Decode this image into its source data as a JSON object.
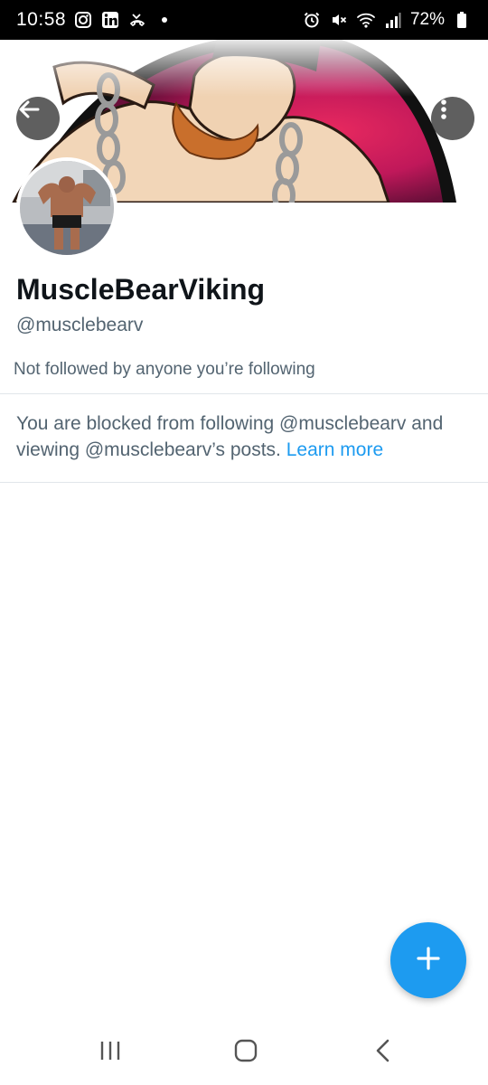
{
  "status_bar": {
    "time": "10:58",
    "battery": "72%",
    "left_icons": [
      "instagram-icon",
      "linkedin-icon",
      "missed-call-icon",
      "dot-icon"
    ],
    "right_icons": [
      "alarm-icon",
      "mute-icon",
      "wifi-icon",
      "signal-icon",
      "battery-icon"
    ]
  },
  "header": {
    "back_icon": "arrow-left-icon",
    "more_icon": "more-vertical-icon"
  },
  "profile": {
    "display_name": "MuscleBearViking",
    "handle": "@musclebearv",
    "followers_note": "Not followed by anyone you’re following"
  },
  "blocked": {
    "message": "You are blocked from following @musclebearv and viewing @musclebearv’s posts.",
    "link": "Learn more"
  },
  "fab": {
    "icon": "plus-icon"
  },
  "nav": {
    "icons": [
      "recent-apps-icon",
      "home-icon",
      "back-icon"
    ]
  },
  "colors": {
    "accent": "#1d9bf0",
    "text_primary": "#0f1419",
    "text_secondary": "#536471",
    "banner_magenta": "#c0185a"
  }
}
